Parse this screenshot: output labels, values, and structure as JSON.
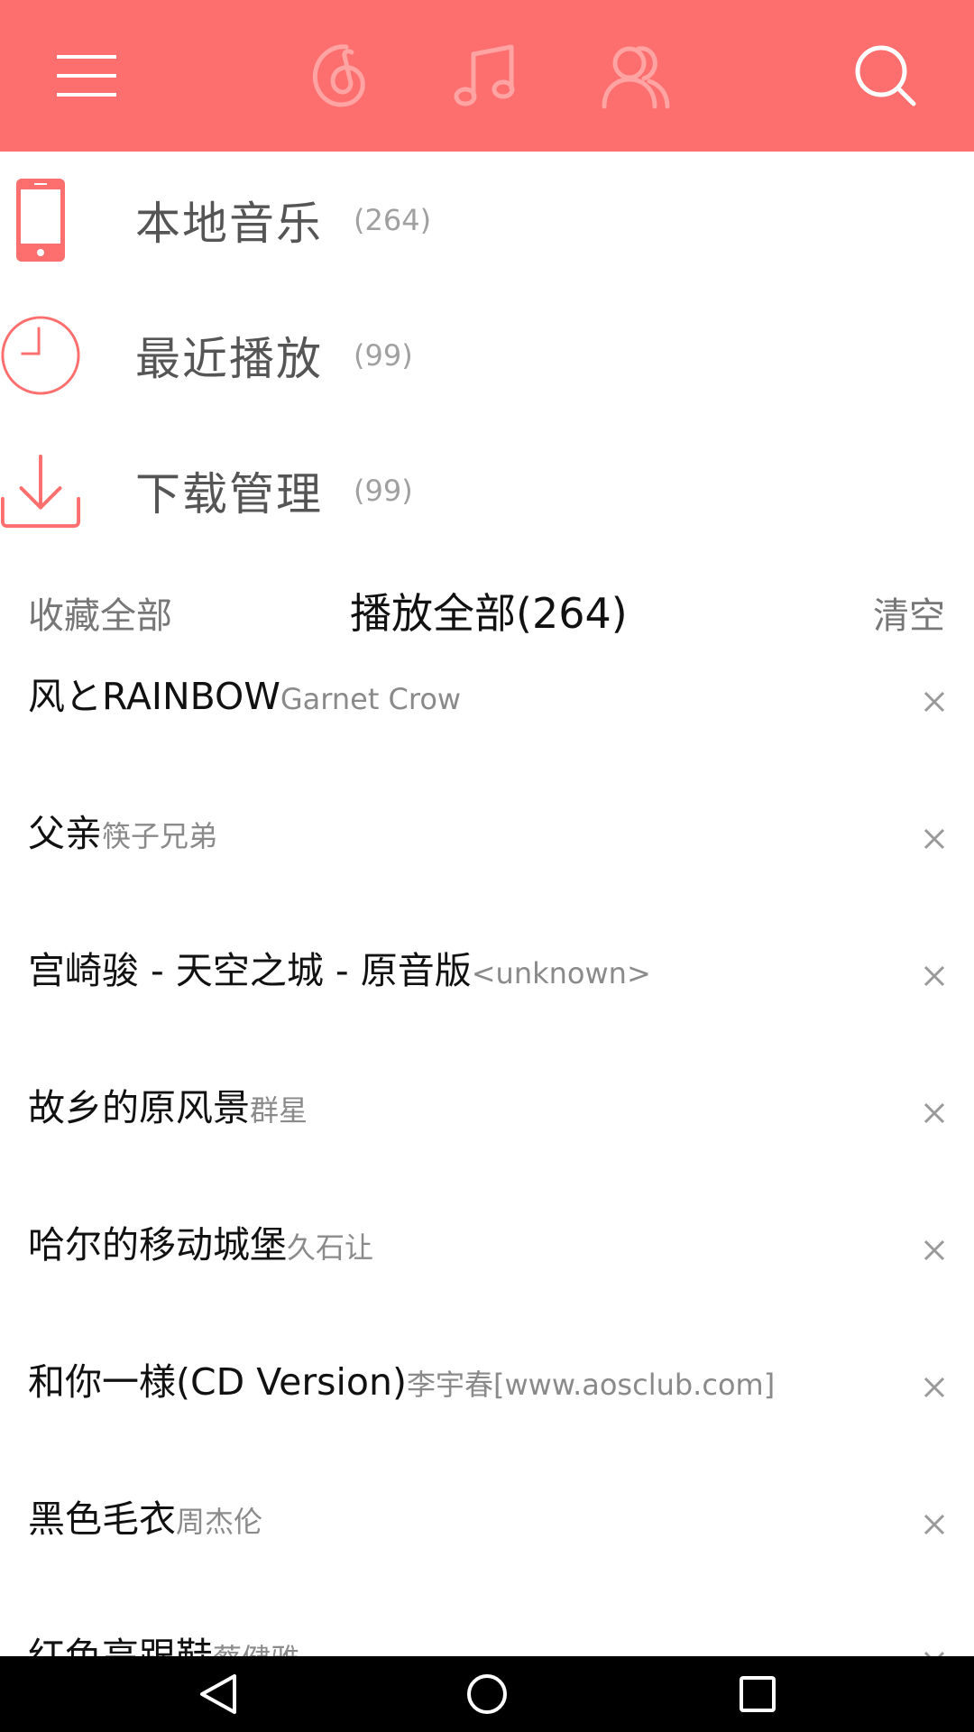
{
  "header": {
    "icons": [
      "menu-icon",
      "netease-music-icon",
      "music-note-icon",
      "friends-icon",
      "search-icon"
    ],
    "background_color": "#fd6e6e",
    "active_icon_color": "#ffffff",
    "inactive_icon_color": "#ffa3a3"
  },
  "menu": {
    "items": [
      {
        "label": "本地音乐",
        "count": "(264)",
        "icon": "phone-icon"
      },
      {
        "label": "最近播放",
        "count": "(99)",
        "icon": "clock-icon"
      },
      {
        "label": "下载管理",
        "count": "(99)",
        "icon": "download-icon"
      }
    ],
    "icon_color": "#fd6e6e"
  },
  "actions": {
    "favorite_all": "收藏全部",
    "play_all": "播放全部(264)",
    "clear": "清空"
  },
  "songs": [
    {
      "title": "风とRAINBOW",
      "artist": "Garnet Crow"
    },
    {
      "title": "父亲",
      "artist": "筷子兄弟"
    },
    {
      "title": "宫崎骏 - 天空之城 - 原音版",
      "artist": "<unknown>"
    },
    {
      "title": "故乡的原风景",
      "artist": "群星"
    },
    {
      "title": "哈尔的移动城堡",
      "artist": "久石让"
    },
    {
      "title": "和你一様(CD Version)",
      "artist": "李宇春[www.aosclub.com]"
    },
    {
      "title": "黑色毛衣",
      "artist": "周杰伦"
    },
    {
      "title": "红色高跟鞋",
      "artist": "蔡健雅"
    }
  ],
  "navbar": {
    "buttons": [
      "back-icon",
      "home-icon",
      "recents-icon"
    ]
  }
}
